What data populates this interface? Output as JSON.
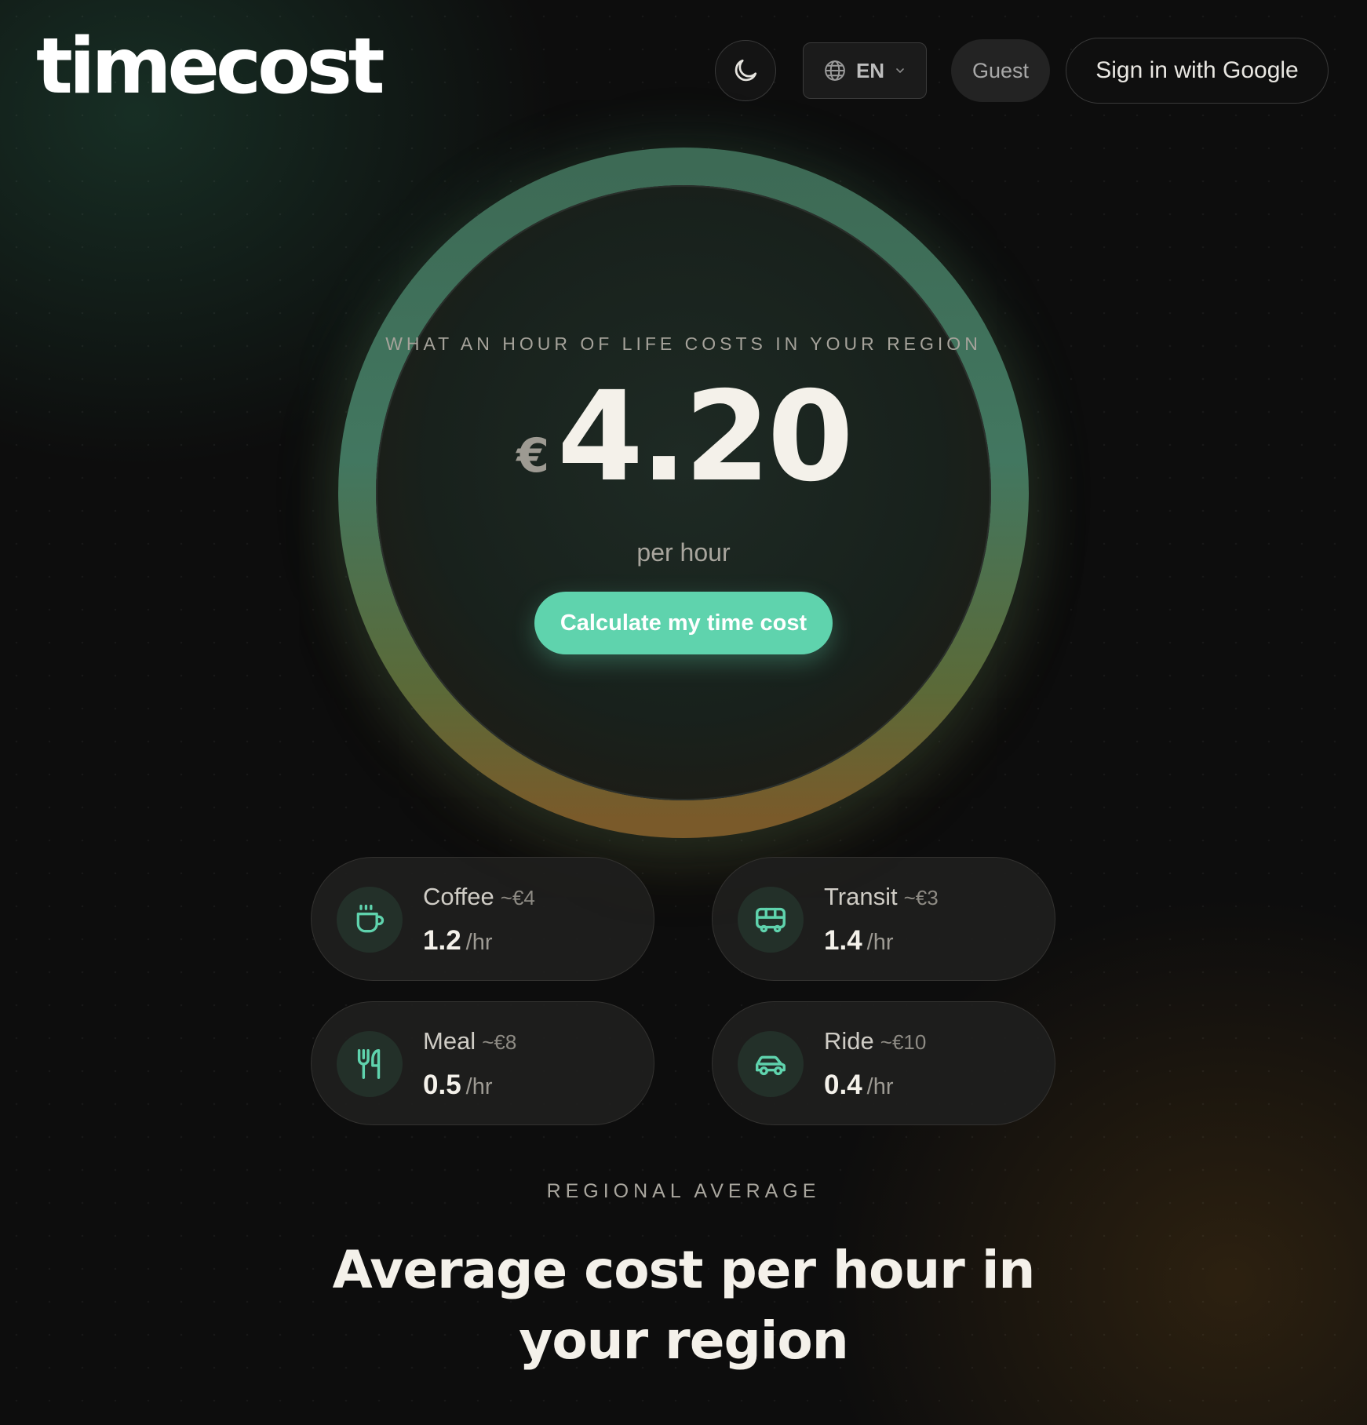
{
  "header": {
    "logo": "timecost",
    "theme_toggle_icon": "moon-icon",
    "language": {
      "icon": "globe-icon",
      "selected": "EN"
    },
    "guest_label": "Guest",
    "sign_in_label": "Sign in with Google"
  },
  "hero": {
    "kicker": "WHAT AN HOUR OF LIFE COSTS IN YOUR REGION",
    "currency": "€",
    "value": "4.20",
    "unit": "per hour",
    "cta_label": "Calculate my time cost",
    "ring_gradient": [
      "#3d6a55",
      "#427760",
      "#5b6a38",
      "#7a5a2a"
    ]
  },
  "comparisons": [
    {
      "icon": "coffee-cup-icon",
      "label": "Coffee",
      "price": "~€4",
      "rate": "1.2",
      "rate_unit": "/hr"
    },
    {
      "icon": "bus-icon",
      "label": "Transit",
      "price": "~€3",
      "rate": "1.4",
      "rate_unit": "/hr"
    },
    {
      "icon": "fork-knife-icon",
      "label": "Meal",
      "price": "~€8",
      "rate": "0.5",
      "rate_unit": "/hr"
    },
    {
      "icon": "car-icon",
      "label": "Ride",
      "price": "~€10",
      "rate": "0.4",
      "rate_unit": "/hr"
    }
  ],
  "section": {
    "kicker": "REGIONAL AVERAGE",
    "title": "Average cost per hour in your region"
  },
  "colors": {
    "accent": "#5fd3ad",
    "background": "#0d0d0d",
    "card_bg": "#1e1e1d",
    "text": "#f4f1ea"
  }
}
